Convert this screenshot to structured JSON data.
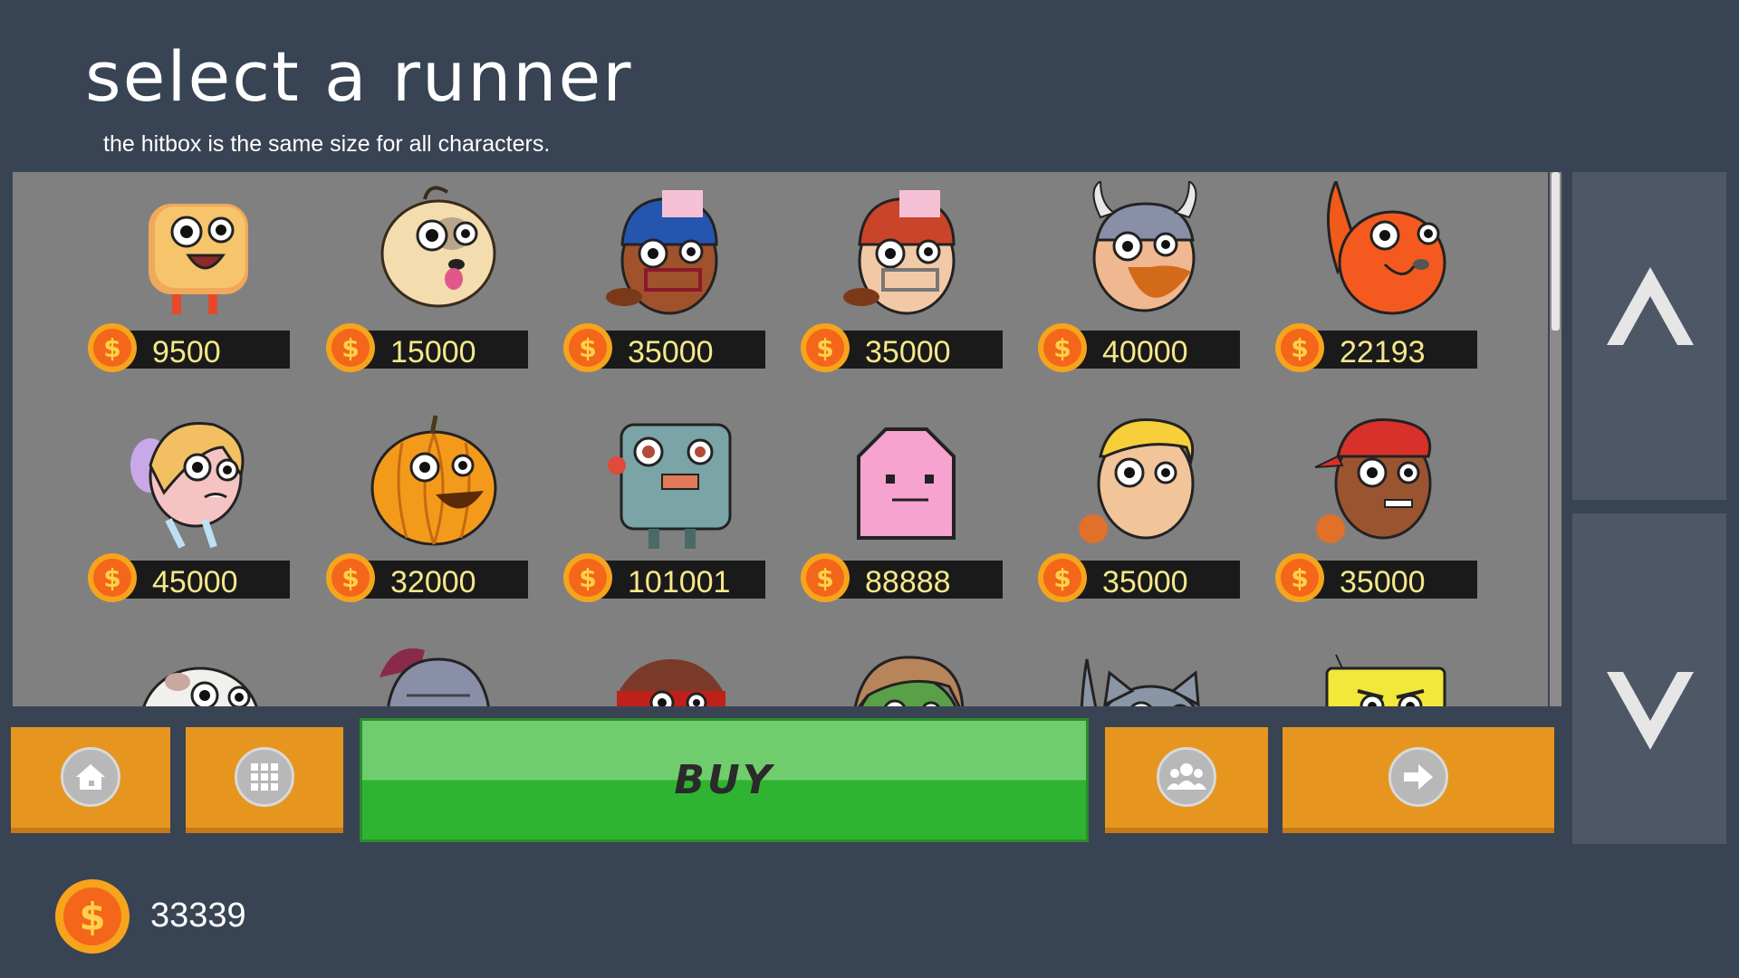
{
  "header": {
    "title": "select a runner",
    "subtitle": "the hitbox is the same size for all characters."
  },
  "characters": [
    {
      "name": "toast",
      "price": "9500"
    },
    {
      "name": "dog",
      "price": "15000"
    },
    {
      "name": "football-player-blue-helmet",
      "price": "35000"
    },
    {
      "name": "football-player-red-helmet",
      "price": "35000"
    },
    {
      "name": "viking",
      "price": "40000"
    },
    {
      "name": "fox",
      "price": "22193"
    },
    {
      "name": "fairy",
      "price": "45000"
    },
    {
      "name": "pumpkin",
      "price": "32000"
    },
    {
      "name": "robot",
      "price": "101001"
    },
    {
      "name": "pink-blob",
      "price": "88888"
    },
    {
      "name": "blonde-kid",
      "price": "35000"
    },
    {
      "name": "red-cap-kid",
      "price": "35000"
    },
    {
      "name": "cow"
    },
    {
      "name": "knight"
    },
    {
      "name": "ninja"
    },
    {
      "name": "zombie-girl"
    },
    {
      "name": "cat"
    },
    {
      "name": "sponge"
    }
  ],
  "toolbar": {
    "home_icon": "home-icon",
    "grid_icon": "grid-icon",
    "buy_label": "BUY",
    "friends_icon": "friends-icon",
    "next_icon": "arrow-right-icon"
  },
  "side": {
    "up_icon": "chevron-up-icon",
    "down_icon": "chevron-down-icon"
  },
  "footer": {
    "coin_balance": "33339"
  },
  "colors": {
    "background": "#384353",
    "grid": "#808080",
    "orange_button": "#e6961f",
    "buy_green": "#2fb431",
    "price_text": "#f4e88a"
  }
}
